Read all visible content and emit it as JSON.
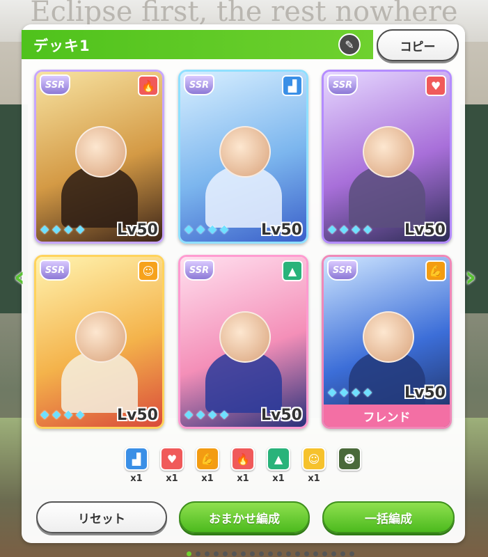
{
  "background_text": "Eclipse first, the rest nowhere",
  "deck": {
    "title": "デッキ1",
    "copy_label": "コピー"
  },
  "cards": [
    {
      "rarity": "SSR",
      "type_icon": "fire-icon",
      "type_glyph": "🔥",
      "type_color": "#f05a5a",
      "level": "Lv50",
      "frame": "#c7a6ff",
      "art": [
        "#f7e3a2",
        "#d49a45",
        "#3b2418"
      ],
      "body": "#2c1c14"
    },
    {
      "rarity": "SSR",
      "type_icon": "boot-icon",
      "type_glyph": "▟",
      "type_color": "#3a8fe6",
      "level": "Lv50",
      "frame": "#8fe0ff",
      "art": [
        "#d8efff",
        "#7cb6ee",
        "#3a5fc9"
      ],
      "body": "#eaf2ff"
    },
    {
      "rarity": "SSR",
      "type_icon": "heart-icon",
      "type_glyph": "♥",
      "type_color": "#f05a5a",
      "level": "Lv50",
      "frame": "#b48cff",
      "art": [
        "#e6d8ff",
        "#a86fd9",
        "#2c2c54"
      ],
      "body": "#5a4f7d"
    },
    {
      "rarity": "SSR",
      "type_icon": "smile-icon",
      "type_glyph": "☺",
      "type_color": "#f6a21c",
      "level": "Lv50",
      "frame": "#ffd35c",
      "art": [
        "#fff3b0",
        "#f4b34b",
        "#d94a3a"
      ],
      "body": "#f5f0e0"
    },
    {
      "rarity": "SSR",
      "type_icon": "cap-icon",
      "type_glyph": "▲",
      "type_color": "#29b37a",
      "level": "Lv50",
      "frame": "#ff9bd0",
      "art": [
        "#ffe0ef",
        "#f48fb8",
        "#28307a"
      ],
      "body": "#2a3a9a"
    },
    {
      "rarity": "SSR",
      "type_icon": "muscle-icon",
      "type_glyph": "💪",
      "type_color": "#f39c12",
      "level": "Lv50",
      "frame": "#f088b8",
      "art": [
        "#cfe6ff",
        "#3c6ed8",
        "#1d2a55"
      ],
      "body": "#233a7a",
      "friend_label": "フレンド"
    }
  ],
  "summary": [
    {
      "icon": "boot-icon",
      "glyph": "▟",
      "color": "#3a8fe6",
      "count": "x1"
    },
    {
      "icon": "heart-icon",
      "glyph": "♥",
      "color": "#f05a5a",
      "count": "x1"
    },
    {
      "icon": "muscle-icon",
      "glyph": "💪",
      "color": "#f39c12",
      "count": "x1"
    },
    {
      "icon": "fire-icon",
      "glyph": "🔥",
      "color": "#f05a5a",
      "count": "x1"
    },
    {
      "icon": "cap-icon",
      "glyph": "▲",
      "color": "#29b37a",
      "count": "x1"
    },
    {
      "icon": "smile-icon",
      "glyph": "☺",
      "color": "#f6c22c",
      "count": "x1"
    },
    {
      "icon": "group-icon",
      "glyph": "☻",
      "color": "#4a6a3a",
      "count": ""
    }
  ],
  "buttons": {
    "reset": "リセット",
    "auto": "おまかせ編成",
    "bulk": "一括編成"
  }
}
